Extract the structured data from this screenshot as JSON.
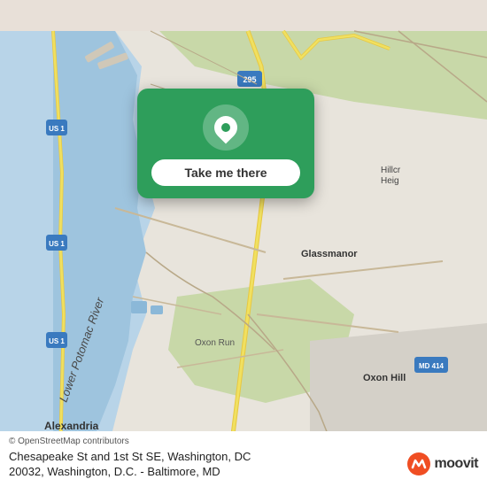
{
  "map": {
    "attribution": "© OpenStreetMap contributors",
    "background_color": "#e8e0d8"
  },
  "popup": {
    "button_label": "Take me there",
    "bg_color": "#2e9e5b"
  },
  "bottom_bar": {
    "location_line1": "Chesapeake St and 1st St SE, Washington, DC",
    "location_line2": "20032, Washington, D.C. - Baltimore, MD",
    "attribution": "© OpenStreetMap contributors",
    "moovit_brand": "moovit"
  }
}
